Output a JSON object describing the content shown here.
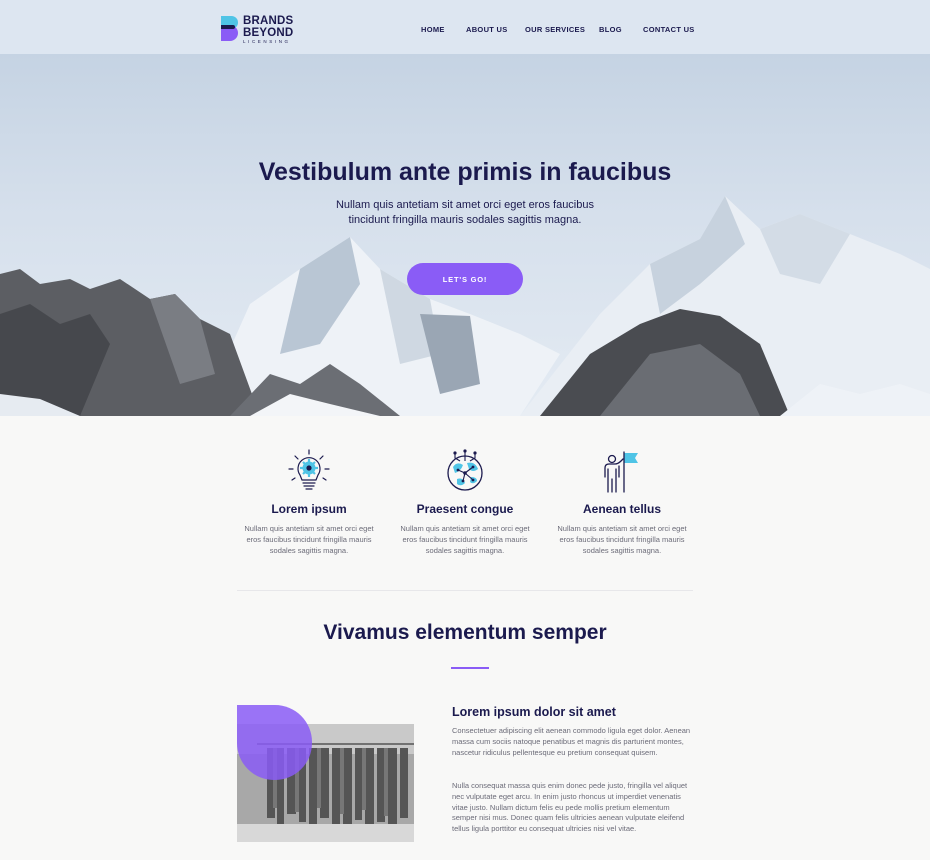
{
  "brand": {
    "line1": "BRANDS",
    "line2": "BEYOND",
    "line3": "LICENSING"
  },
  "nav": {
    "home": "HOME",
    "about": "ABOUT US",
    "services": "OUR SERVICES",
    "blog": "BLOG",
    "contact": "CONTACT US"
  },
  "hero": {
    "title": "Vestibulum ante primis in faucibus",
    "subtitle": "Nullam quis antetiam sit amet orci eget eros faucibus tincidunt fringilla mauris sodales sagittis magna.",
    "button": "LET'S GO!"
  },
  "features": [
    {
      "icon": "lightbulb-gear-icon",
      "title": "Lorem ipsum",
      "text": "Nullam quis antetiam sit amet orci eget eros faucibus tincidunt fringilla mauris sodales sagittis magna."
    },
    {
      "icon": "globe-network-icon",
      "title": "Praesent congue",
      "text": "Nullam quis antetiam sit amet orci eget eros faucibus tincidunt fringilla mauris sodales sagittis magna."
    },
    {
      "icon": "person-flag-icon",
      "title": "Aenean tellus",
      "text": "Nullam quis antetiam sit amet orci eget eros faucibus tincidunt fringilla mauris sodales sagittis magna."
    }
  ],
  "section": {
    "title": "Vivamus elementum semper"
  },
  "article": {
    "title": "Lorem ipsum dolor sit amet",
    "p1": "Consectetuer adipiscing elit aenean commodo ligula eget dolor. Aenean massa cum sociis natoque penatibus et magnis dis parturient montes, nascetur ridiculus pellentesque eu pretium consequat quisem.",
    "p2": "Nulla consequat massa quis enim donec pede justo, fringilla vel aliquet nec vulputate eget arcu. In enim justo rhoncus ut imperdiet venenatis vitae justo. Nullam dictum felis eu pede mollis pretium elementum semper nisi mus. Donec quam felis ultricies aenean vulputate eleifend tellus ligula porttitor eu consequat ultricies nisi vel vitae."
  },
  "colors": {
    "navy": "#1b1a4e",
    "purple": "#8a5cf6",
    "cyan": "#4fc4e6"
  }
}
